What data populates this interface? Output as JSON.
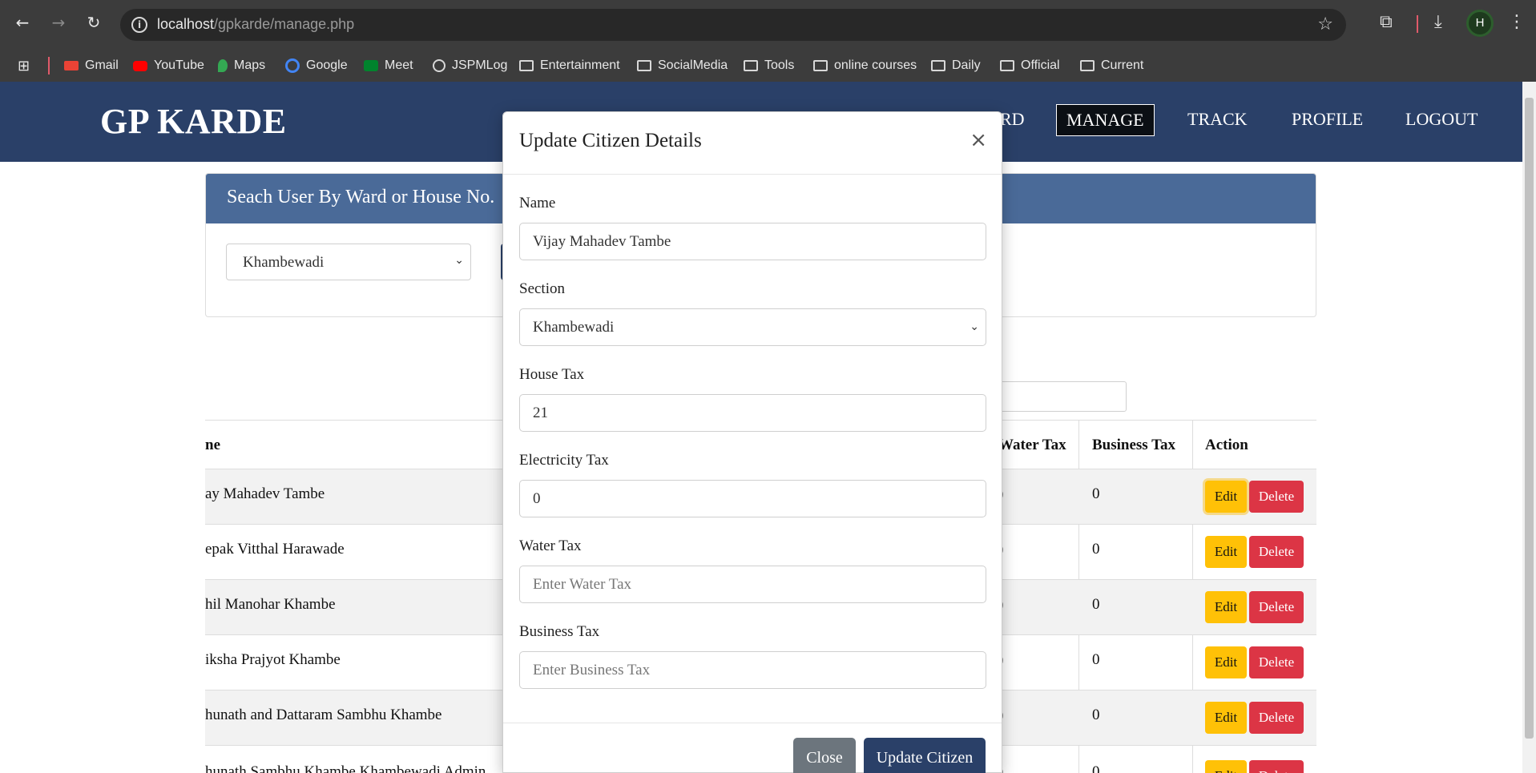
{
  "browser": {
    "url_host": "localhost",
    "url_path": "/gpkarde/manage.php",
    "avatar_letter": "H",
    "bookmarks": [
      "Gmail",
      "YouTube",
      "Maps",
      "Google",
      "Meet",
      "JSPMLog",
      "Entertainment",
      "SocialMedia",
      "Tools",
      "online courses",
      "Daily",
      "Official",
      "Current"
    ]
  },
  "site": {
    "brand": "GP KARDE",
    "nav": [
      "RD",
      "MANAGE",
      "TRACK",
      "PROFILE",
      "LOGOUT"
    ],
    "active_nav": "MANAGE"
  },
  "search": {
    "header": "Seach User By Ward or House No.",
    "ward_selected": "Khambewadi"
  },
  "table": {
    "headers": [
      "ne",
      "Water Tax",
      "Business Tax",
      "Action"
    ],
    "rows": [
      {
        "name": "ay Mahadev Tambe",
        "water": ")",
        "business": "0"
      },
      {
        "name": "epak Vitthal Harawade",
        "water": ")",
        "business": "0"
      },
      {
        "name": "hil Manohar Khambe",
        "water": ")",
        "business": "0"
      },
      {
        "name": "iksha Prajyot Khambe",
        "water": ")",
        "business": "0"
      },
      {
        "name": "hunath and Dattaram Sambhu Khambe",
        "water": ")",
        "business": "0"
      },
      {
        "name": "hunath Sambhu Khambe Khambewadi Admin",
        "water": ")",
        "business": "0"
      }
    ],
    "edit_label": "Edit",
    "delete_label": "Delete"
  },
  "modal": {
    "title": "Update Citizen Details",
    "close_glyph": "×",
    "fields": {
      "name_label": "Name",
      "name_value": "Vijay Mahadev Tambe",
      "section_label": "Section",
      "section_value": "Khambewadi",
      "house_tax_label": "House Tax",
      "house_tax_value": "21",
      "electricity_tax_label": "Electricity Tax",
      "electricity_tax_value": "0",
      "water_tax_label": "Water Tax",
      "water_tax_placeholder": "Enter Water Tax",
      "business_tax_label": "Business Tax",
      "business_tax_placeholder": "Enter Business Tax"
    },
    "close_button": "Close",
    "submit_button": "Update Citizen"
  },
  "colors": {
    "header_bg": "#2a4068",
    "card_header": "#4a6a98",
    "edit": "#ffc107",
    "delete": "#dc3545",
    "close_btn": "#6c757d",
    "submit_btn": "#2a4068"
  }
}
